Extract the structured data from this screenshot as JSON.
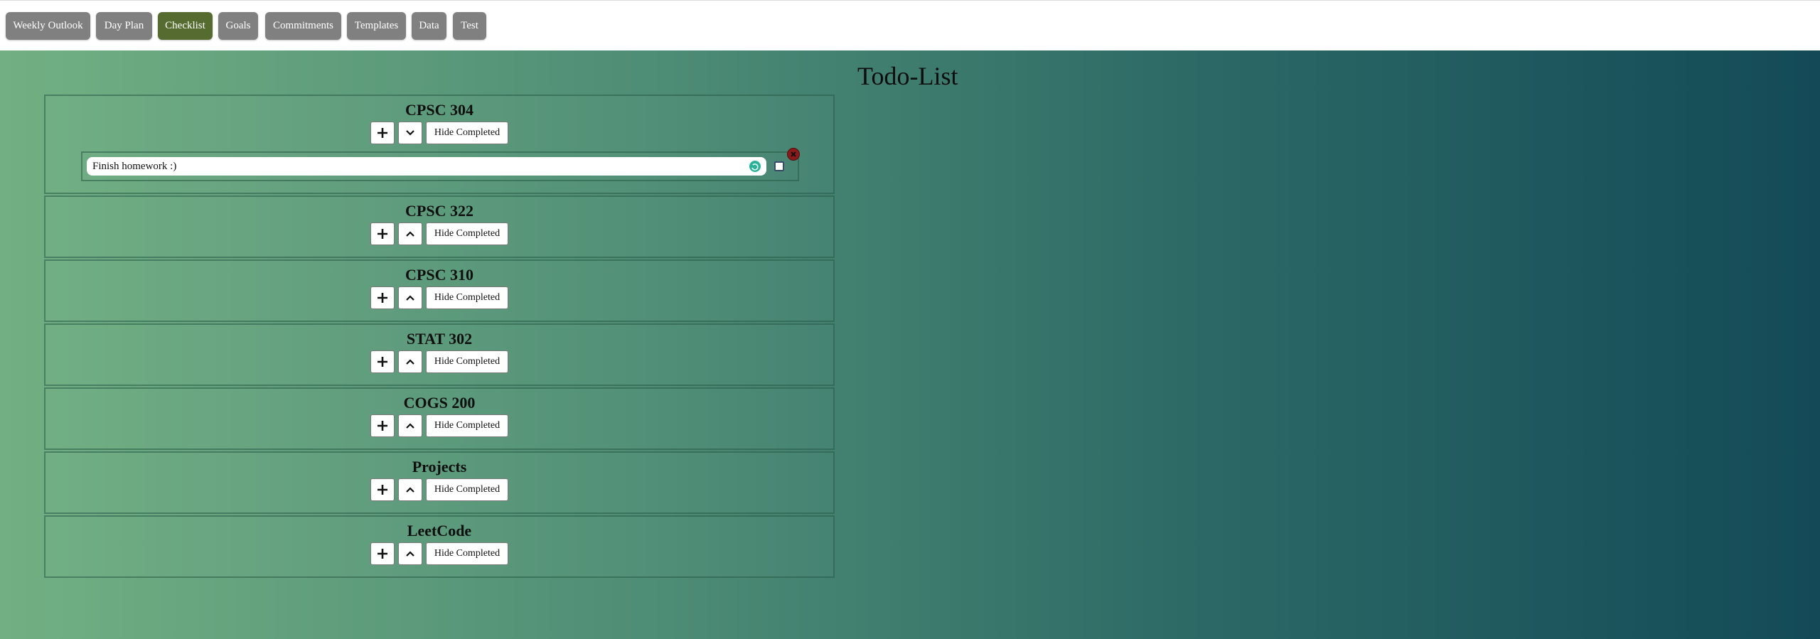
{
  "nav": {
    "tabs": [
      {
        "label": "Weekly Outlook"
      },
      {
        "label": "Day Plan"
      },
      {
        "label": "Checklist",
        "active": true
      },
      {
        "label": "Goals"
      },
      {
        "label": "Commitments"
      },
      {
        "label": "Templates"
      },
      {
        "label": "Data"
      },
      {
        "label": "Test"
      }
    ]
  },
  "page": {
    "title": "Todo-List"
  },
  "categories": [
    {
      "name": "CPSC 304",
      "expanded": true,
      "hide_label": "Hide Completed",
      "items": [
        {
          "text": "Finish homework :)",
          "checked": false
        }
      ]
    },
    {
      "name": "CPSC 322",
      "expanded": false,
      "hide_label": "Hide Completed"
    },
    {
      "name": "CPSC 310",
      "expanded": false,
      "hide_label": "Hide Completed"
    },
    {
      "name": "STAT 302",
      "expanded": false,
      "hide_label": "Hide Completed"
    },
    {
      "name": "COGS 200",
      "expanded": false,
      "hide_label": "Hide Completed"
    },
    {
      "name": "Projects",
      "expanded": false,
      "hide_label": "Hide Completed"
    },
    {
      "name": "LeetCode",
      "expanded": false,
      "hide_label": "Hide Completed"
    }
  ],
  "colors": {
    "active_tab": "#556b2f",
    "inactive_tab": "#808080",
    "gradient_start": "#72b083",
    "gradient_end": "#134a57"
  }
}
